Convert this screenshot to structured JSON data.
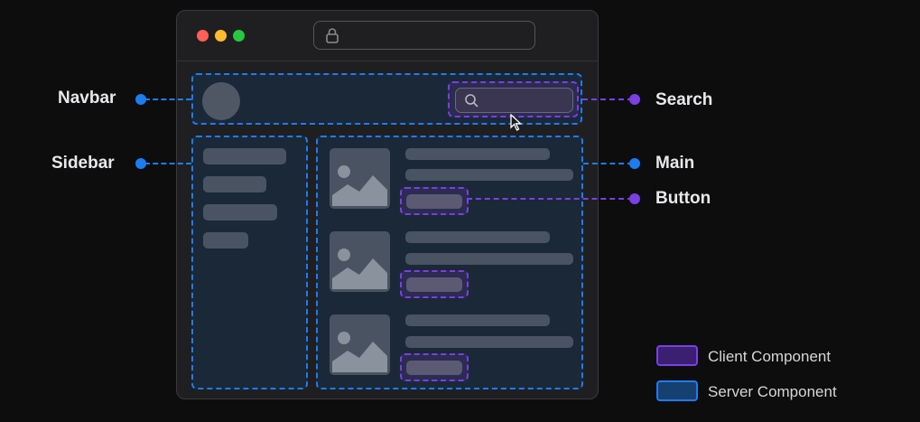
{
  "labels": {
    "navbar": "Navbar",
    "sidebar": "Sidebar",
    "search": "Search",
    "main": "Main",
    "button": "Button"
  },
  "legend": [
    {
      "label": "Client Component",
      "color": "#7b3fe4"
    },
    {
      "label": "Server Component",
      "color": "#1e7cf2"
    }
  ],
  "colors": {
    "server_component": "#1e7cf2",
    "client_component": "#7b3fe4",
    "background": "#0d0d0e"
  },
  "icons": [
    "lock-icon",
    "search-icon",
    "cursor-icon",
    "image-icon"
  ]
}
